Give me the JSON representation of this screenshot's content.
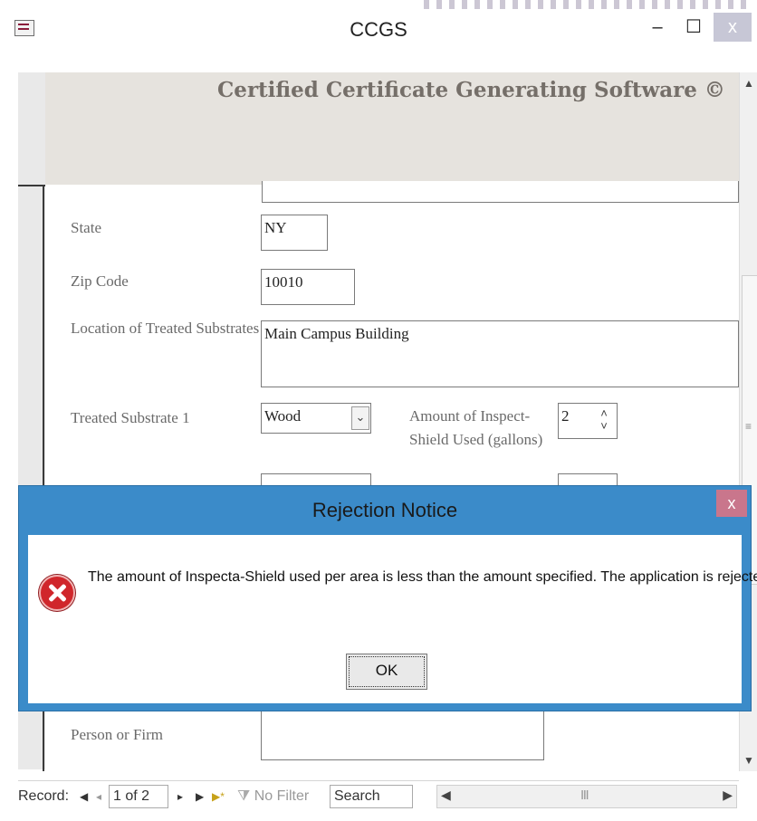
{
  "window": {
    "title": "CCGS",
    "minimize": "–",
    "maximize": "☐",
    "close": "x"
  },
  "header": {
    "title": "Certified Certificate Generating Software ©"
  },
  "form": {
    "state_label": "State",
    "state_value": "NY",
    "zip_label": "Zip Code",
    "zip_value": "10010",
    "location_label": "Location of Treated Substrates",
    "location_value": "Main Campus Building",
    "substrate1_label": "Treated Substrate 1",
    "substrate1_value": "Wood",
    "amount_label_line1": "Amount of Inspect-",
    "amount_label_line2": "Shield Used (gallons)",
    "amount_value": "2",
    "person_label": "Person or Firm",
    "person_value": ""
  },
  "dialog": {
    "title": "Rejection Notice",
    "close": "x",
    "message": "The amount of Inspecta-Shield used per area is less than the amount specified. The application is rejected.",
    "ok_label": "OK",
    "icon": "error-icon"
  },
  "navbar": {
    "record_label": "Record:",
    "first": "◀",
    "prev": "◂",
    "position": "1 of 2",
    "next": "▸",
    "last": "▶",
    "new": "▶*",
    "filter_label": "No Filter",
    "search_label": "Search"
  },
  "colors": {
    "dialog_frame": "#3b8bc9",
    "header_band": "#e6e3de",
    "header_text": "#756f69",
    "error_red": "#d0262b"
  }
}
